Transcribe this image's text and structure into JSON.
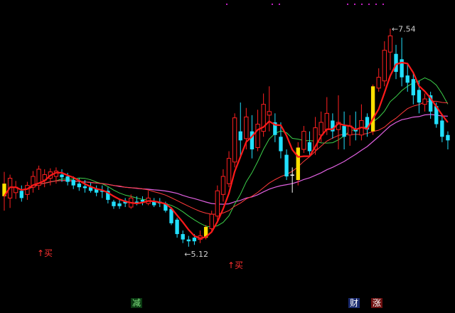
{
  "chart_data": {
    "type": "candlestick",
    "y_range": [
      4.7,
      7.7
    ],
    "high_label": "7.54",
    "low_label": "5.12",
    "buy_label": "↑买",
    "bottom_tags": [
      {
        "text": "减",
        "bg": "#0b3a12",
        "fg": "#7fe27f"
      },
      {
        "text": "财",
        "bg": "#1a2a6e",
        "fg": "#ffffff"
      },
      {
        "text": "涨",
        "bg": "#6e1010",
        "fg": "#ffffff"
      }
    ],
    "colors": {
      "up": "#ff2020",
      "down": "#22e0ff",
      "doji": "#ffffff",
      "highlight": "#ffe000",
      "ma_fast": "#ff1a1a",
      "ma_mid": "#ff3a3a",
      "ma_green": "#3cd04a",
      "ma_slow": "#e060e0",
      "marker": "#c020c0"
    },
    "candles": [
      {
        "o": 5.82,
        "h": 5.95,
        "l": 5.52,
        "c": 5.68,
        "hl": true
      },
      {
        "o": 5.66,
        "h": 5.92,
        "l": 5.55,
        "c": 5.88
      },
      {
        "o": 5.72,
        "h": 5.85,
        "l": 5.65,
        "c": 5.78
      },
      {
        "o": 5.74,
        "h": 5.8,
        "l": 5.62,
        "c": 5.66
      },
      {
        "o": 5.7,
        "h": 5.84,
        "l": 5.64,
        "c": 5.8
      },
      {
        "o": 5.78,
        "h": 5.96,
        "l": 5.72,
        "c": 5.9
      },
      {
        "o": 5.8,
        "h": 6.02,
        "l": 5.75,
        "c": 5.98
      },
      {
        "o": 5.86,
        "h": 5.98,
        "l": 5.78,
        "c": 5.92
      },
      {
        "o": 5.88,
        "h": 5.99,
        "l": 5.8,
        "c": 5.95
      },
      {
        "o": 5.9,
        "h": 6.0,
        "l": 5.82,
        "c": 5.96
      },
      {
        "o": 5.92,
        "h": 5.98,
        "l": 5.84,
        "c": 5.89
      },
      {
        "o": 5.9,
        "h": 5.94,
        "l": 5.8,
        "c": 5.84
      },
      {
        "o": 5.86,
        "h": 5.9,
        "l": 5.76,
        "c": 5.8
      },
      {
        "o": 5.82,
        "h": 5.88,
        "l": 5.74,
        "c": 5.78
      },
      {
        "o": 5.79,
        "h": 5.86,
        "l": 5.72,
        "c": 5.77
      },
      {
        "o": 5.78,
        "h": 5.83,
        "l": 5.72,
        "c": 5.74
      },
      {
        "o": 5.76,
        "h": 5.8,
        "l": 5.68,
        "c": 5.72
      },
      {
        "o": 5.74,
        "h": 5.8,
        "l": 5.66,
        "c": 5.73
      },
      {
        "o": 5.74,
        "h": 5.78,
        "l": 5.6,
        "c": 5.64
      },
      {
        "o": 5.62,
        "h": 5.64,
        "l": 5.54,
        "c": 5.57
      },
      {
        "o": 5.6,
        "h": 5.65,
        "l": 5.54,
        "c": 5.57
      },
      {
        "o": 5.63,
        "h": 5.66,
        "l": 5.56,
        "c": 5.6
      },
      {
        "o": 5.56,
        "h": 5.7,
        "l": 5.54,
        "c": 5.66
      },
      {
        "o": 5.62,
        "h": 5.68,
        "l": 5.58,
        "c": 5.6
      },
      {
        "o": 5.64,
        "h": 5.68,
        "l": 5.58,
        "c": 5.62
      },
      {
        "o": 5.6,
        "h": 5.74,
        "l": 5.58,
        "c": 5.66
      },
      {
        "o": 5.62,
        "h": 5.66,
        "l": 5.56,
        "c": 5.58
      },
      {
        "o": 5.62,
        "h": 5.66,
        "l": 5.56,
        "c": 5.6
      },
      {
        "o": 5.6,
        "h": 5.62,
        "l": 5.5,
        "c": 5.52
      },
      {
        "o": 5.54,
        "h": 5.56,
        "l": 5.36,
        "c": 5.38
      },
      {
        "o": 5.42,
        "h": 5.44,
        "l": 5.22,
        "c": 5.26
      },
      {
        "o": 5.26,
        "h": 5.3,
        "l": 5.16,
        "c": 5.2
      },
      {
        "o": 5.2,
        "h": 5.24,
        "l": 5.12,
        "c": 5.18
      },
      {
        "o": 5.22,
        "h": 5.26,
        "l": 5.14,
        "c": 5.18
      },
      {
        "o": 5.2,
        "h": 5.3,
        "l": 5.16,
        "c": 5.24
      },
      {
        "o": 5.22,
        "h": 5.36,
        "l": 5.2,
        "c": 5.34,
        "hl": true
      },
      {
        "o": 5.32,
        "h": 5.52,
        "l": 5.28,
        "c": 5.48
      },
      {
        "o": 5.46,
        "h": 5.8,
        "l": 5.4,
        "c": 5.74
      },
      {
        "o": 5.7,
        "h": 5.98,
        "l": 5.62,
        "c": 5.9
      },
      {
        "o": 5.82,
        "h": 6.18,
        "l": 5.78,
        "c": 6.1
      },
      {
        "o": 6.06,
        "h": 6.6,
        "l": 6.0,
        "c": 6.55
      },
      {
        "o": 6.4,
        "h": 6.72,
        "l": 6.1,
        "c": 6.3
      },
      {
        "o": 6.32,
        "h": 6.66,
        "l": 6.2,
        "c": 6.56
      },
      {
        "o": 6.4,
        "h": 6.58,
        "l": 6.1,
        "c": 6.2
      },
      {
        "o": 6.22,
        "h": 6.64,
        "l": 6.18,
        "c": 6.48
      },
      {
        "o": 6.4,
        "h": 6.82,
        "l": 6.34,
        "c": 6.7
      },
      {
        "o": 6.58,
        "h": 6.9,
        "l": 6.4,
        "c": 6.62
      },
      {
        "o": 6.5,
        "h": 6.6,
        "l": 6.28,
        "c": 6.36
      },
      {
        "o": 6.34,
        "h": 6.5,
        "l": 6.1,
        "c": 6.18
      },
      {
        "o": 6.14,
        "h": 6.2,
        "l": 5.86,
        "c": 5.9
      },
      {
        "o": 5.92,
        "h": 6.0,
        "l": 5.72,
        "c": 5.92
      },
      {
        "o": 5.86,
        "h": 6.28,
        "l": 5.8,
        "c": 6.22,
        "hl": true
      },
      {
        "o": 6.2,
        "h": 6.46,
        "l": 6.16,
        "c": 6.4
      },
      {
        "o": 6.28,
        "h": 6.4,
        "l": 6.12,
        "c": 6.18
      },
      {
        "o": 6.2,
        "h": 6.56,
        "l": 6.14,
        "c": 6.44
      },
      {
        "o": 6.36,
        "h": 6.62,
        "l": 6.28,
        "c": 6.5
      },
      {
        "o": 6.42,
        "h": 6.78,
        "l": 6.36,
        "c": 6.6
      },
      {
        "o": 6.52,
        "h": 6.6,
        "l": 6.32,
        "c": 6.4
      },
      {
        "o": 6.42,
        "h": 6.8,
        "l": 6.2,
        "c": 6.5
      },
      {
        "o": 6.46,
        "h": 6.62,
        "l": 6.2,
        "c": 6.34
      },
      {
        "o": 6.36,
        "h": 6.58,
        "l": 6.24,
        "c": 6.46
      },
      {
        "o": 6.42,
        "h": 6.62,
        "l": 6.3,
        "c": 6.4
      },
      {
        "o": 6.36,
        "h": 6.7,
        "l": 6.3,
        "c": 6.52
      },
      {
        "o": 6.56,
        "h": 6.6,
        "l": 6.34,
        "c": 6.42
      },
      {
        "o": 6.4,
        "h": 6.92,
        "l": 6.36,
        "c": 6.9,
        "hl": true
      },
      {
        "o": 6.88,
        "h": 7.1,
        "l": 6.84,
        "c": 7.0
      },
      {
        "o": 6.96,
        "h": 7.4,
        "l": 6.9,
        "c": 7.3
      },
      {
        "o": 7.28,
        "h": 7.54,
        "l": 7.08,
        "c": 7.46
      },
      {
        "o": 7.26,
        "h": 7.36,
        "l": 6.98,
        "c": 7.06
      },
      {
        "o": 7.2,
        "h": 7.44,
        "l": 6.9,
        "c": 7.0
      },
      {
        "o": 7.02,
        "h": 7.14,
        "l": 6.84,
        "c": 6.94
      },
      {
        "o": 6.98,
        "h": 7.06,
        "l": 6.7,
        "c": 6.8
      },
      {
        "o": 6.86,
        "h": 6.96,
        "l": 6.6,
        "c": 6.72
      },
      {
        "o": 6.7,
        "h": 6.82,
        "l": 6.62,
        "c": 6.76
      },
      {
        "o": 6.8,
        "h": 6.84,
        "l": 6.54,
        "c": 6.62
      },
      {
        "o": 6.68,
        "h": 6.72,
        "l": 6.44,
        "c": 6.48
      },
      {
        "o": 6.52,
        "h": 6.58,
        "l": 6.28,
        "c": 6.34
      },
      {
        "o": 6.36,
        "h": 6.4,
        "l": 6.2,
        "c": 6.3
      }
    ]
  }
}
